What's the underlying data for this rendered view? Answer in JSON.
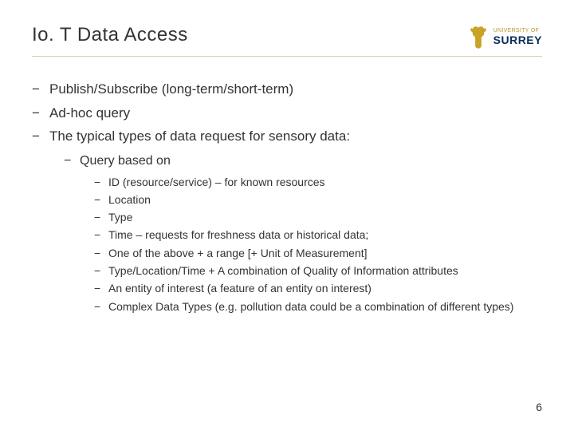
{
  "title": "Io. T Data Access",
  "logo": {
    "university_of": "UNIVERSITY OF",
    "name": "SURREY"
  },
  "bullets": {
    "b1": "Publish/Subscribe (long-term/short-term)",
    "b2": "Ad-hoc query",
    "b3": "The typical types of data request for sensory data:",
    "b3_1": "Query based on",
    "b3_1_items": {
      "i1": "ID (resource/service) – for known resources",
      "i2": "Location",
      "i3": "Type",
      "i4": "Time – requests for freshness data or historical data;",
      "i5": "One of the above + a range [+ Unit of Measurement]",
      "i6": "Type/Location/Time + A combination of Quality of Information attributes",
      "i7": "An entity of interest (a feature of an entity on interest)",
      "i8": "Complex Data Types (e.g. pollution data could be a combination of different types)"
    }
  },
  "page_number": "6"
}
